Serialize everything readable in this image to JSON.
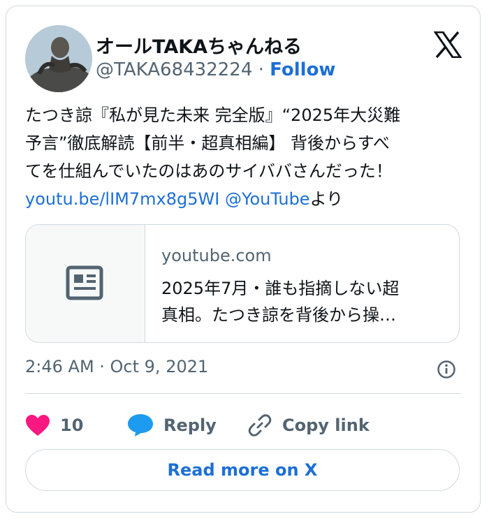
{
  "author": {
    "display_name": "オールTAKAちゃんねる",
    "handle": "@TAKA68432224",
    "separator": "·",
    "follow_label": "Follow"
  },
  "tweet": {
    "lines": [
      "たつき諒『私が見た未来 完全版』“2025年大災難",
      "予言”徹底解読【前半・超真相編】 背後からすべ",
      "てを仕組んでいたのはあのサイババさんだった！"
    ],
    "link_url": "youtu.be/lIM7mx8g5WI",
    "mention": "@YouTube",
    "suffix": "より"
  },
  "link_card": {
    "domain": "youtube.com",
    "title_line1": "2025年7月・誰も指摘しない超",
    "title_line2": "真相。たつき諒を背後から操…",
    "icon": "article-icon"
  },
  "timestamp": "2:46 AM · Oct 9, 2021",
  "actions": {
    "like_count": "10",
    "reply_label": "Reply",
    "copy_link_label": "Copy link"
  },
  "read_more_label": "Read more on X",
  "colors": {
    "accent": "#1d6fd6",
    "text": "#0f1419",
    "secondary": "#536471",
    "border": "#cfd9de",
    "like": "#f91880",
    "reply": "#1d9bf0"
  }
}
